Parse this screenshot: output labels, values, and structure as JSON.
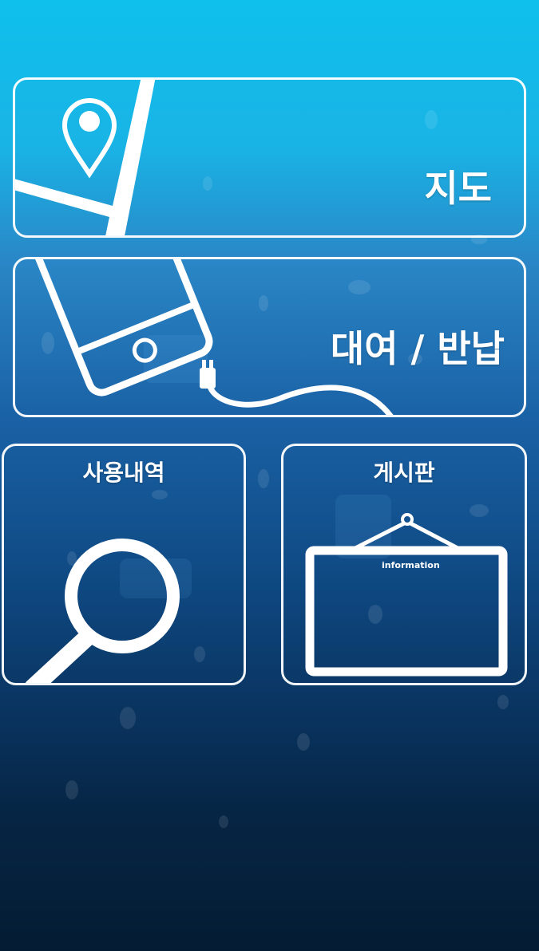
{
  "menu": {
    "map": {
      "label": "지도",
      "icon": "map-pin-phone-icon"
    },
    "rent_return": {
      "label": "대여 / 반납",
      "icon": "phone-charger-icon"
    },
    "history": {
      "label": "사용내역",
      "icon": "magnifier-icon"
    },
    "board": {
      "label": "게시판",
      "icon": "hanging-sign-icon",
      "sign_text": "information"
    }
  },
  "colors": {
    "background_top": "#0fc0ec",
    "background_bottom": "#041c33",
    "stroke": "#ffffff"
  }
}
